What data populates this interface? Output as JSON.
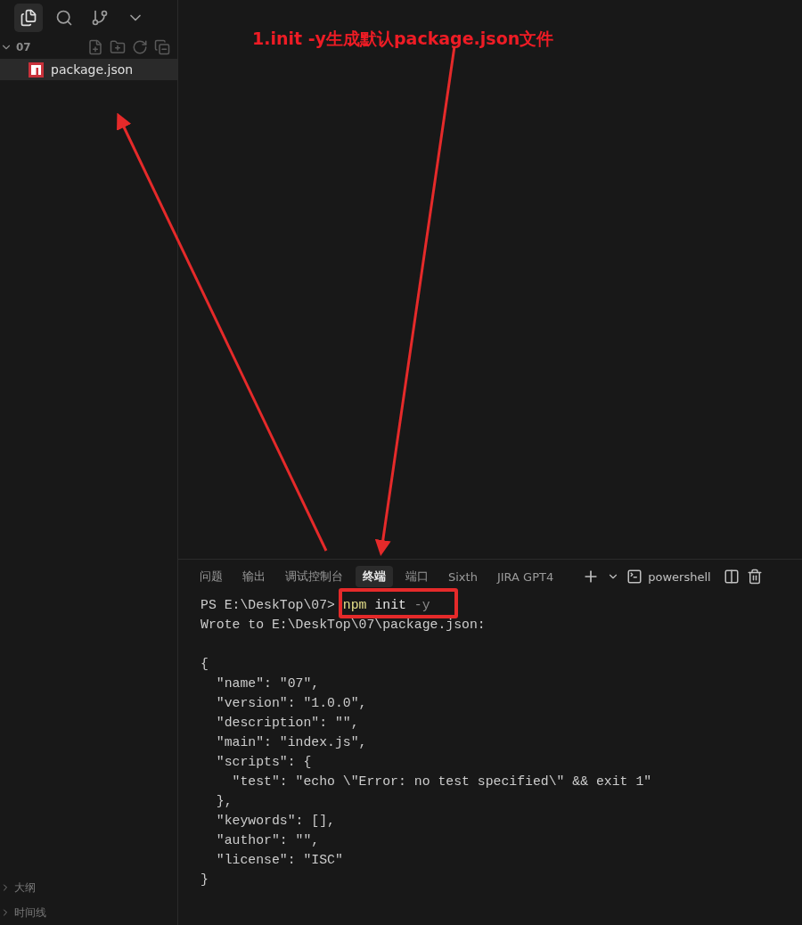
{
  "activity_bar": {
    "items": [
      {
        "selected": true
      },
      {
        "selected": false
      },
      {
        "selected": false
      },
      {
        "selected": false
      }
    ]
  },
  "explorer": {
    "folder": "07",
    "expanded": true,
    "files": [
      {
        "name": "package.json",
        "selected": true
      }
    ]
  },
  "sidebar_sections": [
    {
      "label": "大纲",
      "expanded": false
    },
    {
      "label": "时间线",
      "expanded": false
    }
  ],
  "panel": {
    "tabs": [
      {
        "label": "问题",
        "selected": false
      },
      {
        "label": "输出",
        "selected": false
      },
      {
        "label": "调试控制台",
        "selected": false
      },
      {
        "label": "终端",
        "selected": true
      },
      {
        "label": "端口",
        "selected": false
      },
      {
        "label": "Sixth",
        "selected": false
      },
      {
        "label": "JIRA GPT4",
        "selected": false
      }
    ],
    "shell": "powershell",
    "prompt": "PS E:\\DeskTop\\07>",
    "command": "npm",
    "argument": "init",
    "flag": "-y",
    "lines": [
      {
        "kind": "text",
        "text": "Wrote to E:\\DeskTop\\07\\package.json:"
      },
      {
        "kind": "blank"
      },
      {
        "kind": "text",
        "text": "{"
      },
      {
        "kind": "text",
        "text": "  \"name\": \"07\","
      },
      {
        "kind": "text",
        "text": "  \"version\": \"1.0.0\","
      },
      {
        "kind": "text",
        "text": "  \"description\": \"\","
      },
      {
        "kind": "text",
        "text": "  \"main\": \"index.js\","
      },
      {
        "kind": "text",
        "text": "  \"scripts\": {"
      },
      {
        "kind": "text",
        "text": "    \"test\": \"echo \\\"Error: no test specified\\\" && exit 1\""
      },
      {
        "kind": "text",
        "text": "  },"
      },
      {
        "kind": "text",
        "text": "  \"keywords\": [],"
      },
      {
        "kind": "text",
        "text": "  \"author\": \"\","
      },
      {
        "kind": "text",
        "text": "  \"license\": \"ISC\""
      },
      {
        "kind": "text",
        "text": "}"
      }
    ]
  },
  "annotation": {
    "caption": "1.init -y生成默认package.json文件"
  }
}
